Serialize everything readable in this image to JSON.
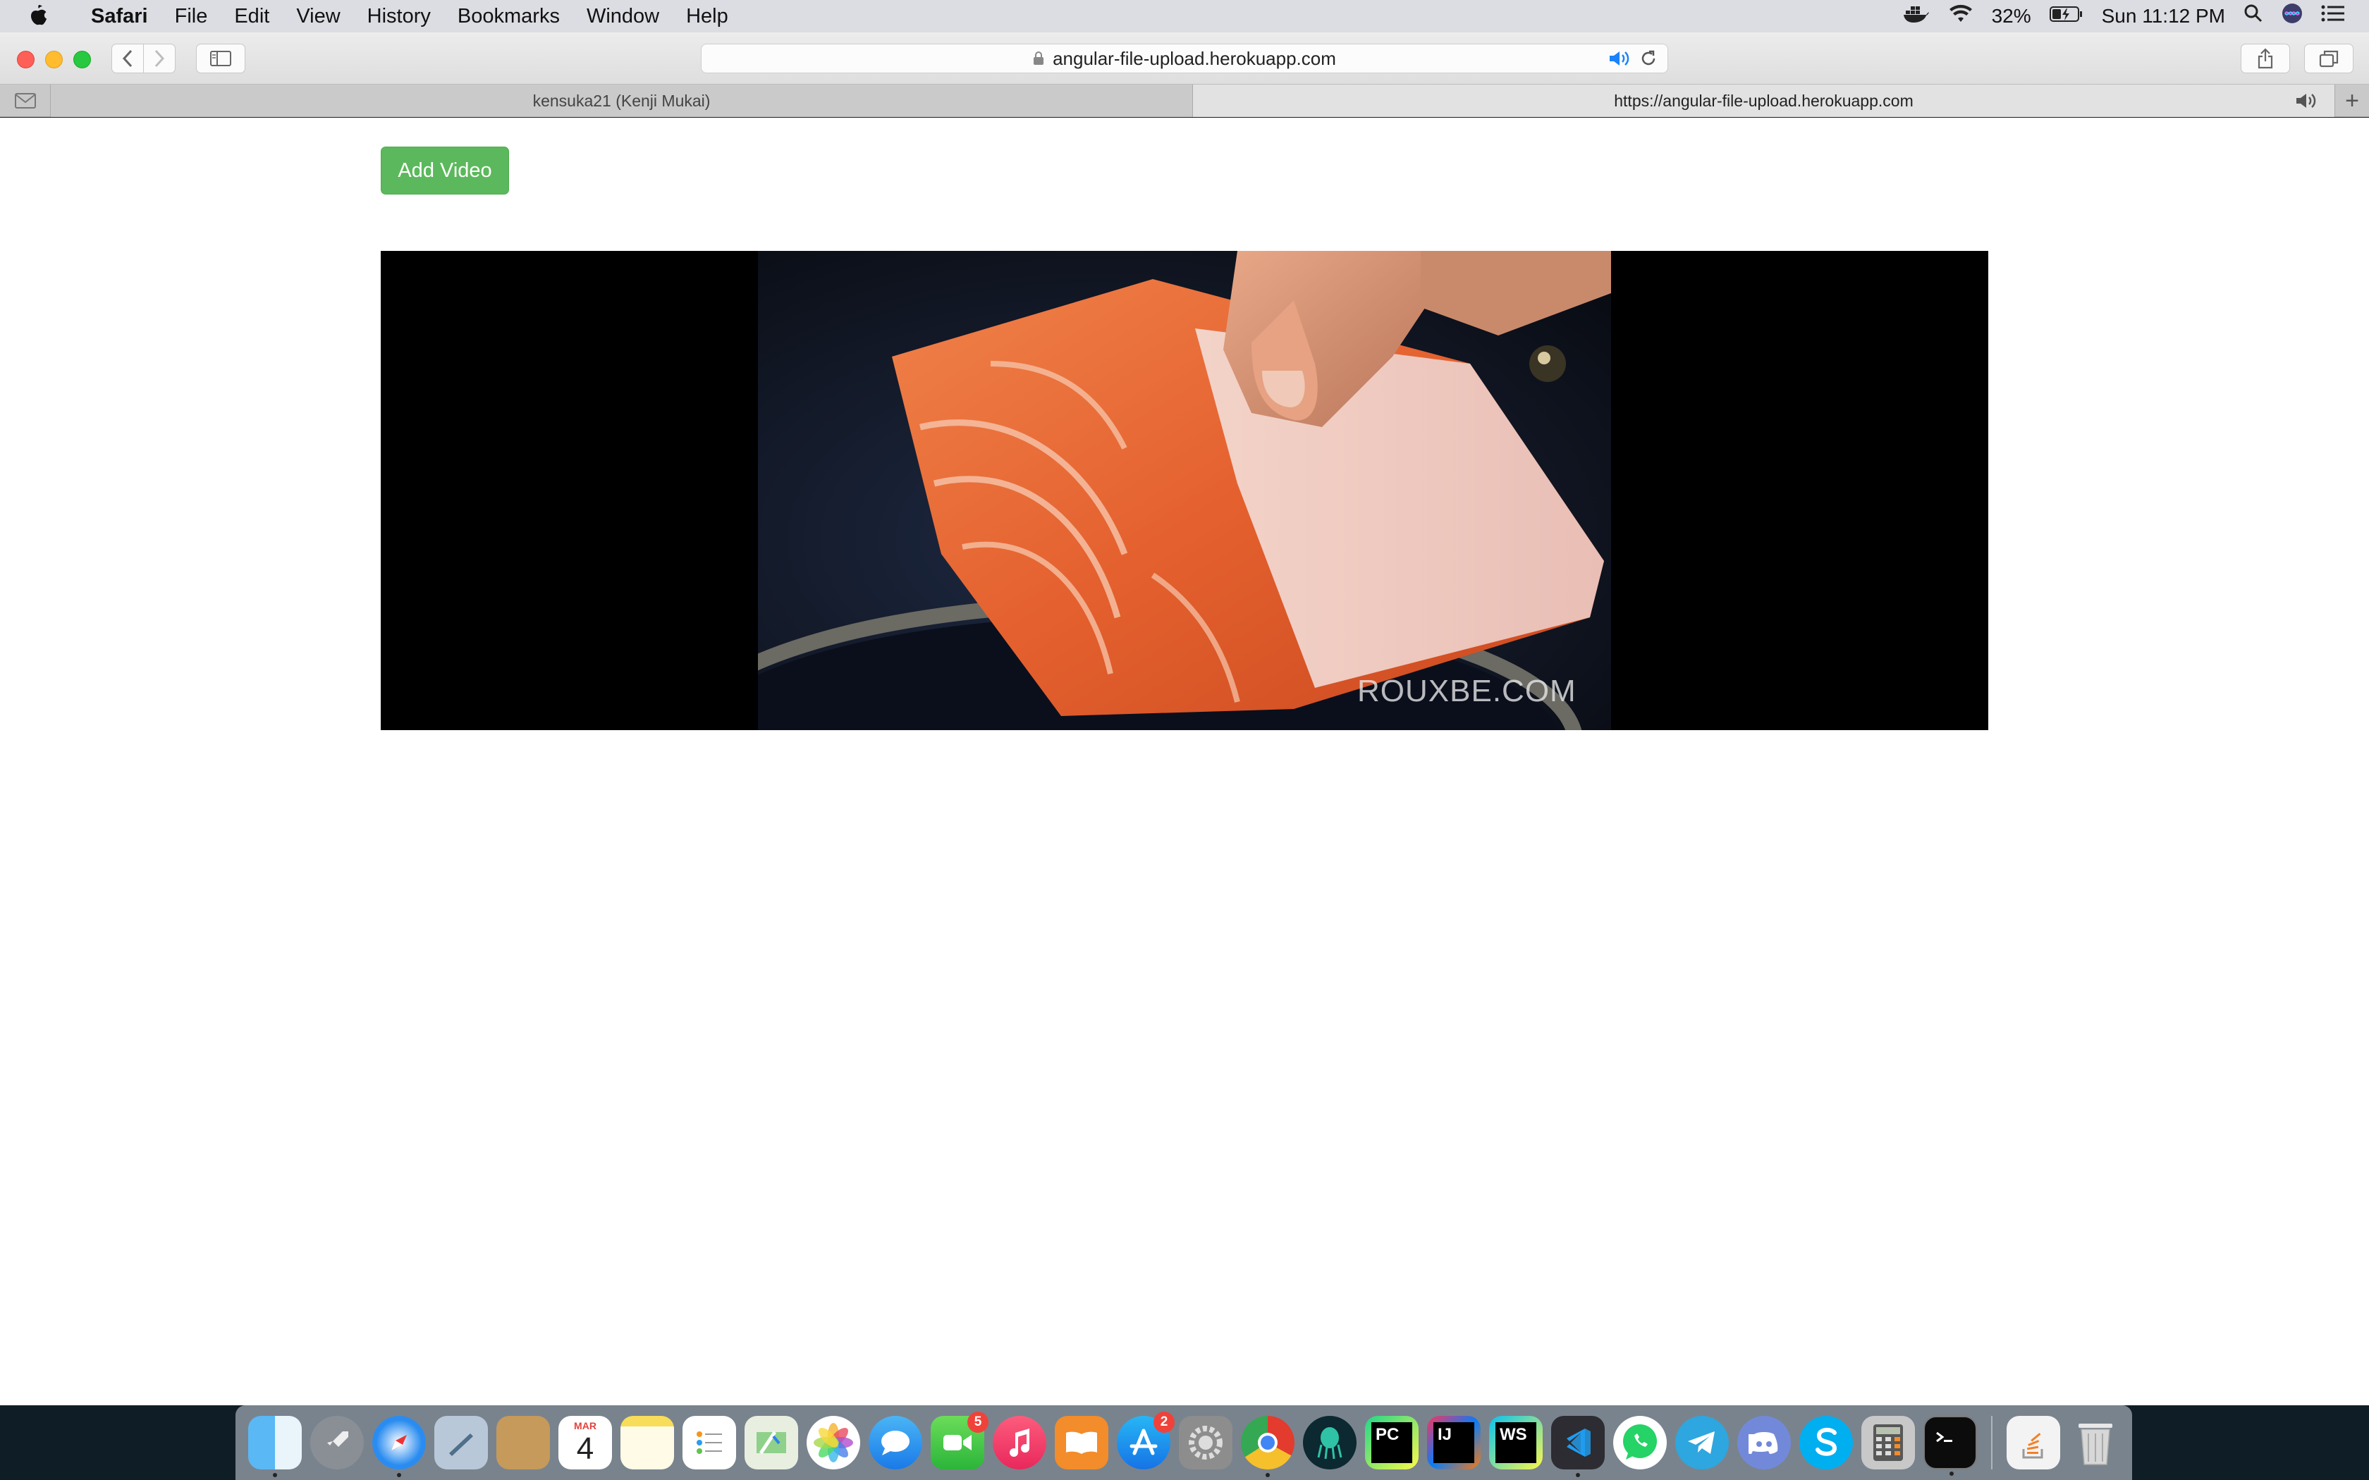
{
  "menubar": {
    "app_name": "Safari",
    "items": [
      "File",
      "Edit",
      "View",
      "History",
      "Bookmarks",
      "Window",
      "Help"
    ],
    "battery": "32%",
    "clock": "Sun 11:12 PM"
  },
  "toolbar": {
    "address": "angular-file-upload.herokuapp.com"
  },
  "tabs": {
    "tab1_title": "kensuka21 (Kenji Mukai)",
    "tab2_title": "https://angular-file-upload.herokuapp.com",
    "new_tab": "+"
  },
  "page": {
    "add_video_label": "Add Video",
    "video_watermark": "ROUXBE.COM"
  },
  "dock": {
    "calendar_month": "MAR",
    "calendar_day": "4",
    "facetime_badge": "5",
    "appstore_badge": "2",
    "pycharm_label": "PC",
    "intellij_label": "IJ",
    "webstorm_label": "WS"
  },
  "colors": {
    "add_video_button": "#5cb85c",
    "traffic_close": "#fe5f57",
    "traffic_min": "#febc2e",
    "traffic_max": "#28c840"
  }
}
